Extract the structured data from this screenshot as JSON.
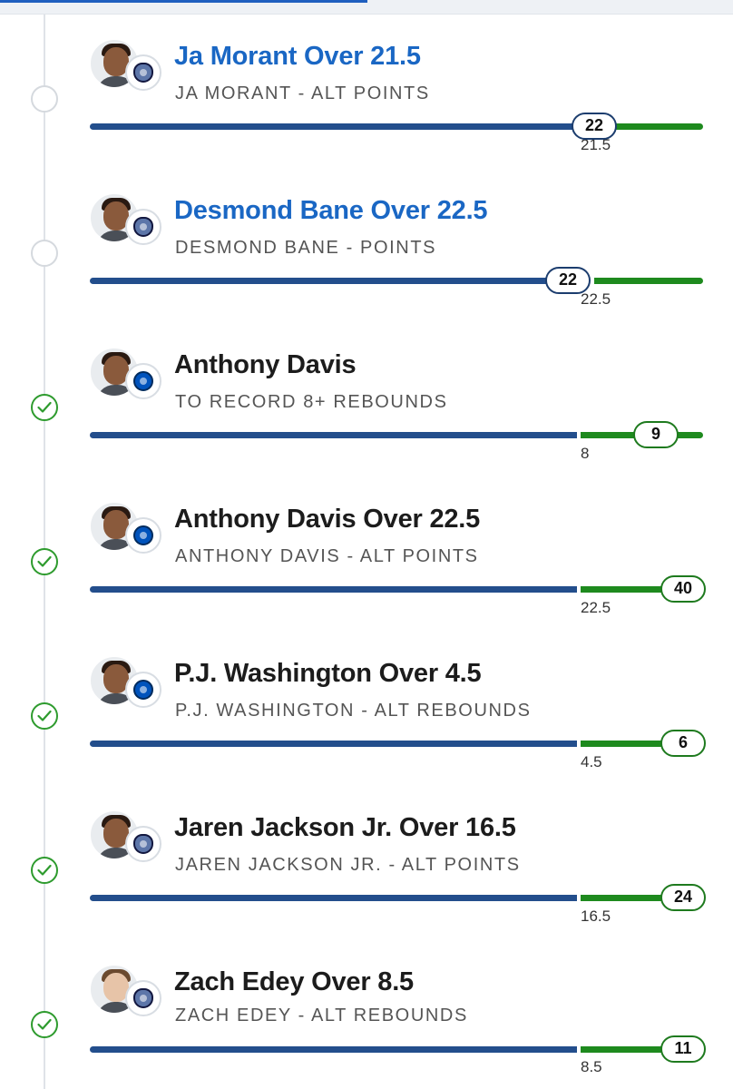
{
  "legs": [
    {
      "title": "Ja Morant Over 21.5",
      "subtitle": "JA MORANT - ALT POINTS",
      "line": "21.5",
      "actual": "22",
      "status": "pending",
      "team": "grizzlies-logo",
      "status_icon": "empty-circle-icon"
    },
    {
      "title": "Desmond Bane Over 22.5",
      "subtitle": "DESMOND BANE - POINTS",
      "line": "22.5",
      "actual": "22",
      "status": "pending",
      "team": "grizzlies-logo",
      "status_icon": "empty-circle-icon"
    },
    {
      "title": "Anthony Davis",
      "subtitle": "TO RECORD 8+ REBOUNDS",
      "line": "8",
      "actual": "9",
      "status": "won",
      "team": "mavericks-logo",
      "status_icon": "check-circle-icon"
    },
    {
      "title": "Anthony Davis Over 22.5",
      "subtitle": "ANTHONY DAVIS - ALT POINTS",
      "line": "22.5",
      "actual": "40",
      "status": "won",
      "team": "mavericks-logo",
      "status_icon": "check-circle-icon"
    },
    {
      "title": "P.J. Washington Over 4.5",
      "subtitle": "P.J. WASHINGTON - ALT REBOUNDS",
      "line": "4.5",
      "actual": "6",
      "status": "won",
      "team": "mavericks-logo",
      "status_icon": "check-circle-icon"
    },
    {
      "title": "Jaren Jackson Jr. Over 16.5",
      "subtitle": "JAREN JACKSON JR. - ALT POINTS",
      "line": "16.5",
      "actual": "24",
      "status": "won",
      "team": "grizzlies-logo",
      "status_icon": "check-circle-icon"
    },
    {
      "title": "Zach Edey Over 8.5",
      "subtitle": "ZACH EDEY - ALT REBOUNDS",
      "line": "8.5",
      "actual": "11",
      "status": "won",
      "team": "grizzlies-logo",
      "status_icon": "check-circle-icon"
    }
  ],
  "colors": {
    "pending_title": "#1a67c4",
    "progress_blue": "#234e8c",
    "progress_green": "#1e8a1e",
    "won_check": "#2e9b2e"
  }
}
